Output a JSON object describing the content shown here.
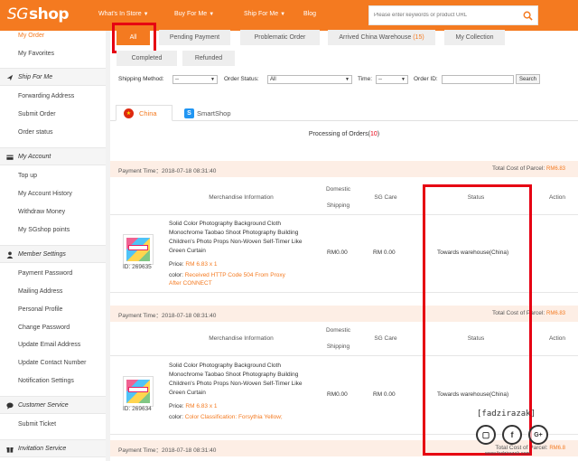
{
  "header": {
    "logo_prefix": "SG",
    "logo_suffix": "shop",
    "nav": [
      "What's In Store",
      "Buy For Me",
      "Ship For Me",
      "Blog"
    ],
    "search_placeholder": "Please enter keywords or product URL",
    "brand_color": "#f47a20"
  },
  "sidebar": {
    "top_items": [
      "My Order",
      "My Favorites"
    ],
    "sections": [
      {
        "title": "Ship For Me",
        "icon": "plane-icon",
        "items": [
          "Forwarding Address",
          "Submit Order",
          "Order status"
        ]
      },
      {
        "title": "My Account",
        "icon": "card-icon",
        "items": [
          "Top up",
          "My Account History",
          "Withdraw Money",
          "My SGshop points"
        ]
      },
      {
        "title": "Member Settings",
        "icon": "user-icon",
        "items": [
          "Payment Password",
          "Mailing Address",
          "Personal Profile",
          "Change Password",
          "Update Email Address",
          "Update Contact Number",
          "Notification Settings"
        ]
      },
      {
        "title": "Customer Service",
        "icon": "chat-icon",
        "items": [
          "Submit Ticket"
        ]
      },
      {
        "title": "Invitation Service",
        "icon": "gift-icon",
        "items": []
      }
    ]
  },
  "tabs": [
    {
      "label": "All"
    },
    {
      "label": "Pending Payment"
    },
    {
      "label": "Problematic Order"
    },
    {
      "label": "Arrived China Warehouse",
      "count": "(15)"
    },
    {
      "label": "My Collection"
    },
    {
      "label": "Completed"
    },
    {
      "label": "Refunded"
    }
  ],
  "filters": {
    "shipping_method_label": "Shipping Method:",
    "shipping_method_value": "--",
    "order_status_label": "Order Status:",
    "order_status_value": "All",
    "time_label": "Time:",
    "time_value": "--",
    "order_id_label": "Order ID:",
    "order_id_value": "",
    "search_button": "Search"
  },
  "source_tabs": [
    "China",
    "SmartShop"
  ],
  "processing": {
    "text": "Processing of Orders(",
    "count": "10",
    "close": ")"
  },
  "columns": {
    "merchandise": "Merchandise Information",
    "domestic": "Domestic",
    "shipping": "Shipping",
    "sgcare": "SG Care",
    "status": "Status",
    "action": "Action"
  },
  "orders": [
    {
      "payment_label": "Payment Time：",
      "payment_time": "2018-07-18 08:31:40",
      "total_label": "Total Cost of Parcel:",
      "total_value": "RM6.83",
      "product_id": "ID: 269635",
      "name_lines": [
        "Solid Color Photography Background Cloth",
        "Monochrome Taobao Shoot Photography Building",
        "Children's Photo Props Non-Woven Self-Timer Like",
        "Green Curtain"
      ],
      "price_label": "Price: ",
      "price_value": "RM 6.83",
      "qty": "x 1",
      "color_label": "color: ",
      "color_lines": [
        "Received HTTP Code 504 From Proxy",
        "After CONNECT"
      ],
      "domestic_shipping": "RM0.00",
      "sg_care": "RM 0.00",
      "status": "Towards warehouse(China)"
    },
    {
      "payment_label": "Payment Time：",
      "payment_time": "2018-07-18 08:31:40",
      "total_label": "Total Cost of Parcel:",
      "total_value": "RM6.83",
      "product_id": "ID: 269634",
      "name_lines": [
        "Solid Color Photography Background Cloth",
        "Monochrome Taobao Shoot Photography Building",
        "Children's Photo Props Non-Woven Self-Timer Like",
        "Green Curtain"
      ],
      "price_label": "Price: ",
      "price_value": "RM 6.83",
      "qty": "x 1",
      "color_label": "color: ",
      "color_lines": [
        "Color Classification: Forsythia Yellow;"
      ],
      "domestic_shipping": "RM0.00",
      "sg_care": "RM 0.00",
      "status": "Towards warehouse(China)"
    }
  ],
  "third_payment": {
    "payment_label": "Payment Time：",
    "payment_time": "2018-07-18 08:31:40",
    "total_label": "Total Cost of Parcel:",
    "total_value": "RM6.8"
  },
  "watermark": {
    "name": "[fadzirazak]",
    "icons": [
      "instagram-icon",
      "facebook-icon",
      "googleplus-icon"
    ],
    "url": "www.fadzirazak.com"
  }
}
